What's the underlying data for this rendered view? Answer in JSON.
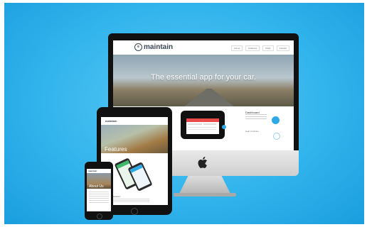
{
  "desktop": {
    "brand": "maintain",
    "badge": "e",
    "nav": [
      "Home",
      "Features",
      "FAQs",
      "Contact"
    ],
    "hero_title": "The essential app for your car.",
    "section_question": "...",
    "section_heading": "Dashboard",
    "section_sub": "Help & Advice"
  },
  "tablet": {
    "brand": "maintain",
    "hero_title": "Features",
    "caption": "New Features!"
  },
  "phone": {
    "brand": "maintain",
    "hero_title": "About Us"
  },
  "colors": {
    "background": "#32b4ec",
    "accent": "#2fa8e6",
    "brand_text": "#3a4654",
    "phone_bar": "#e94b4b"
  }
}
